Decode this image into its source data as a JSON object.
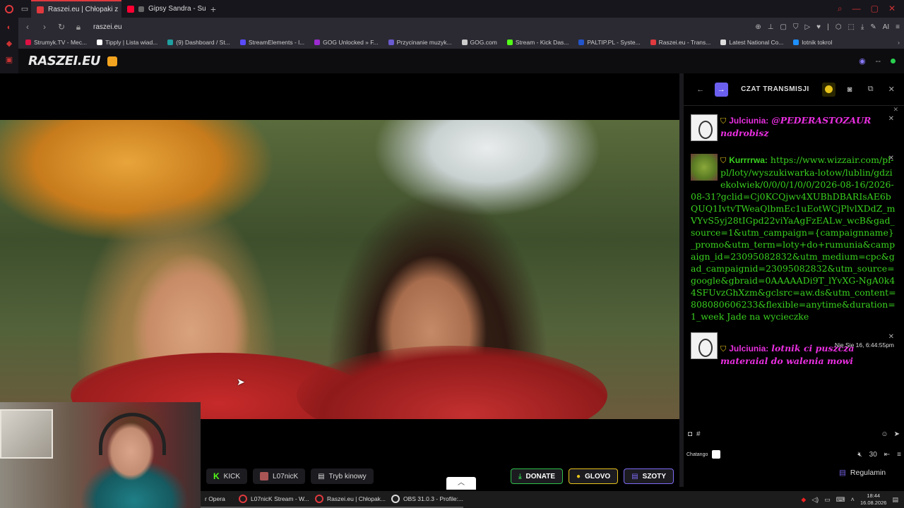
{
  "browser": {
    "tabs": [
      {
        "label": "Raszei.eu | Chłopaki z",
        "active": true,
        "color": "#e0393e"
      },
      {
        "label": "Gipsy Sandra - Sunen",
        "active": false,
        "color": "#ff0033"
      }
    ],
    "url": "raszei.eu",
    "bookmarks": [
      {
        "label": "Strumyk.TV - Mec...",
        "color": "#d14"
      },
      {
        "label": "Tipply | Lista wiad...",
        "color": "#fff"
      },
      {
        "label": "(9) Dashboard / St...",
        "color": "#20a0a0"
      },
      {
        "label": "StreamElements - l...",
        "color": "#5a4bff"
      },
      {
        "label": "GOG Unlocked » F...",
        "color": "#9b2bd1"
      },
      {
        "label": "Przycinanie muzyk...",
        "color": "#6a5bd1"
      },
      {
        "label": "GOG.com",
        "color": "#ccc"
      },
      {
        "label": "Stream - Kick Das...",
        "color": "#53fc18"
      },
      {
        "label": "PALTIP.PL - Syste...",
        "color": "#2255cc"
      },
      {
        "label": "Raszei.eu - Trans...",
        "color": "#e0393e"
      },
      {
        "label": "Latest National Co...",
        "color": "#ddd"
      },
      {
        "label": "lotnik tokrol",
        "color": "#1e90ff"
      }
    ]
  },
  "site": {
    "logo": "RASZEI.EU",
    "viewer_count": "--"
  },
  "player": {
    "kick_label": "KICK",
    "user_label": "L07nicK",
    "cinema_label": "Tryb kinowy",
    "donate_label": "DONATE",
    "glovo_label": "GLOVO",
    "szoty_label": "SZOTY"
  },
  "chat": {
    "title": "CZAT TRANSMISJI",
    "messages": [
      {
        "user": "Julciunia:",
        "text": "@PEDERASTOZAUR nadrobisz",
        "style": "pink"
      },
      {
        "user": "Kurrrrwa:",
        "text": "https://www.wizzair.com/pl-pl/loty/wyszukiwarka-lotow/lublin/gdziekolwiek/0/0/0/1/0/0/2026-08-16/2026-08-31?gclid=Cj0KCQjwv4XUBhDBARIsAE6bQUQ1IvtvTWeaQlbmEc1uEotWCjPlvlXDdZ_mVYvS5yj28tIGpd22viYaAgFzEALw_wcB&gad_source=1&utm_campaign={campaignname}_promo&utm_term=loty+do+rumunia&campaign_id=23095082832&utm_medium=cpc&gad_campaignid=23095082832&utm_source=google&gbraid=0AAAAADi9T_lYvXG-NgA0k44SFUvzGhXzm&gclsrc=aw.ds&utm_content=808080606233&flexible=anytime&duration=1_week Jade na wycieczke",
        "style": "green"
      },
      {
        "user": "Julciunia:",
        "text": "lotnik ci puszcza materaial do walenia mowi",
        "style": "pink",
        "timestamp": "Nie Sie 16, 6:44:55pm"
      }
    ],
    "input_hash": "#",
    "chatango_label": "Chatango",
    "font_size": "30",
    "regulamin_label": "Regulamin"
  },
  "taskbar": {
    "items": [
      {
        "label": "r Opera"
      },
      {
        "label": "L07nicK Stream - W..."
      },
      {
        "label": "Raszei.eu | Chłopak..."
      },
      {
        "label": "OBS 31.0.3 - Profile:..."
      }
    ],
    "time": "18:44",
    "date": "16.08.2026"
  }
}
